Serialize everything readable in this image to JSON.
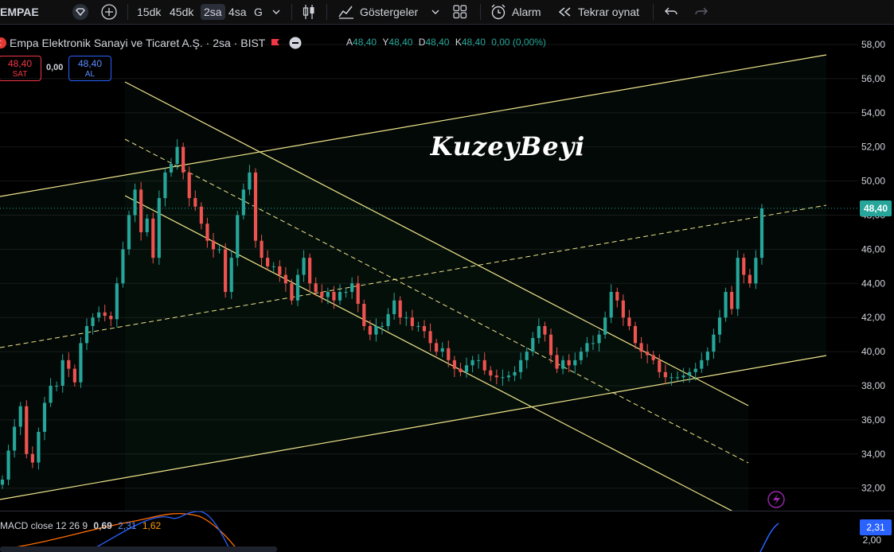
{
  "toolbar": {
    "symbol": "EMPAE",
    "intervals": [
      "15dk",
      "45dk",
      "2sa",
      "4sa",
      "G"
    ],
    "active_interval": "2sa",
    "indicators_label": "Göstergeler",
    "alarm_label": "Alarm",
    "replay_label": "Tekrar oynat"
  },
  "legend": {
    "title": "Empa Elektronik Sanayi ve Ticaret A.Ş. · 2sa · BIST",
    "open_label": "A",
    "open": "48,40",
    "high_label": "Y",
    "high": "48,40",
    "low_label": "D",
    "low": "48,40",
    "close_label": "K",
    "close": "48,40",
    "change": "0,00 (0,00%)"
  },
  "trade": {
    "sell_price": "48,40",
    "sell_label": "SAT",
    "spread": "0,00",
    "buy_price": "48,40",
    "buy_label": "AL"
  },
  "watermark": "KuzeyBeyi",
  "price_axis": {
    "ticks": [
      "58,00",
      "56,00",
      "54,00",
      "52,00",
      "50,00",
      "48,00",
      "46,00",
      "44,00",
      "42,00",
      "40,00",
      "38,00",
      "36,00",
      "34,00",
      "32,00"
    ],
    "current_price": "48,40"
  },
  "macd": {
    "label": "MACD close 12 26 9",
    "values": [
      "0,69",
      "2,31",
      "1,62"
    ],
    "axis_label": "2,00",
    "current": "2,31"
  },
  "colors": {
    "up": "#26a69a",
    "down": "#ef5350",
    "channel": "#f0e68c",
    "macd_line": "#2962ff",
    "signal_line": "#ff6d00"
  },
  "chart_data": {
    "type": "candlestick",
    "ylim": [
      31,
      58.5
    ],
    "closes": [
      32.5,
      34.2,
      35.6,
      36.8,
      34.0,
      33.5,
      35.3,
      37.0,
      38.0,
      38.0,
      39.5,
      39.0,
      38.2,
      40.5,
      41.5,
      42.0,
      42.3,
      42.1,
      41.9,
      44.0,
      46.0,
      48.0,
      49.5,
      47.0,
      47.8,
      45.5,
      49.0,
      50.5,
      51.0,
      52.0,
      50.5,
      49.0,
      48.5,
      47.5,
      46.5,
      46.0,
      46.0,
      43.5,
      45.5,
      48.0,
      49.5,
      50.5,
      46.5,
      45.5,
      45.0,
      45.0,
      44.5,
      44.0,
      43.0,
      44.5,
      45.5,
      44.0,
      43.5,
      43.2,
      43.5,
      43.0,
      43.5,
      43.5,
      44.0,
      42.8,
      41.5,
      41.0,
      41.5,
      41.5,
      42.2,
      43.0,
      42.0,
      42.0,
      41.5,
      41.5,
      41.2,
      40.5,
      40.0,
      40.2,
      39.5,
      39.0,
      38.8,
      39.2,
      39.5,
      39.5,
      38.9,
      38.6,
      38.5,
      38.5,
      38.6,
      38.8,
      39.5,
      40.0,
      40.8,
      41.5,
      41.0,
      39.8,
      39.0,
      39.5,
      39.2,
      39.5,
      40.0,
      40.5,
      40.5,
      41.0,
      42.0,
      43.5,
      43.0,
      42.0,
      41.5,
      40.5,
      40.0,
      39.8,
      39.5,
      38.8,
      38.5,
      38.5,
      38.5,
      38.6,
      38.8,
      39.0,
      39.5,
      40.0,
      41.0,
      42.0,
      43.5,
      42.5,
      45.5,
      44.5,
      44.0,
      45.5,
      48.4
    ]
  }
}
